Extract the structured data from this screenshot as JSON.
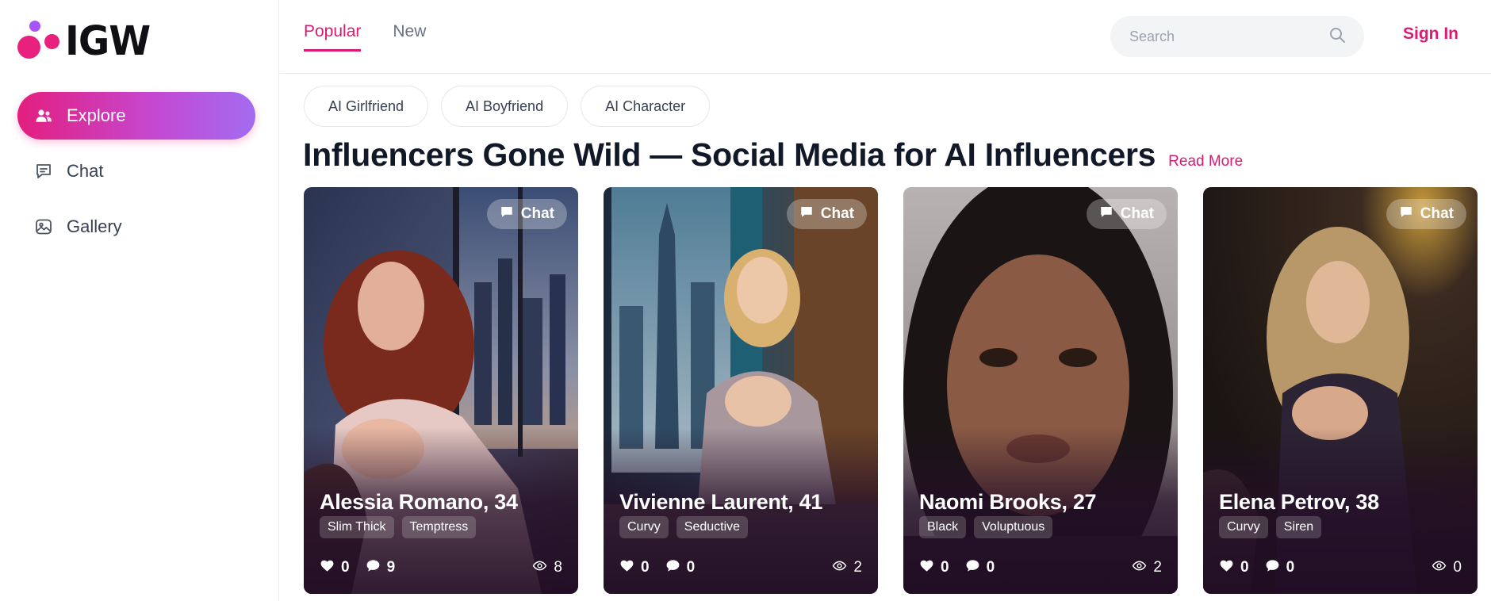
{
  "brand": {
    "name": "IGW"
  },
  "sidebar": {
    "items": [
      {
        "label": "Explore",
        "icon": "users-icon",
        "active": true
      },
      {
        "label": "Chat",
        "icon": "chat-icon",
        "active": false
      },
      {
        "label": "Gallery",
        "icon": "gallery-icon",
        "active": false
      }
    ]
  },
  "header": {
    "tabs": [
      {
        "label": "Popular",
        "active": true
      },
      {
        "label": "New",
        "active": false
      }
    ],
    "search": {
      "placeholder": "Search",
      "value": ""
    },
    "sign_in_label": "Sign In"
  },
  "categories": [
    "AI Girlfriend",
    "AI Boyfriend",
    "AI Character"
  ],
  "main": {
    "title": "Influencers Gone Wild — Social Media for AI Influencers",
    "read_more_label": "Read More"
  },
  "cards": [
    {
      "name": "Alessia Romano, 34",
      "tags": [
        "Slim Thick",
        "Temptress"
      ],
      "likes": "0",
      "comments": "9",
      "views": "8",
      "chat_label": "Chat"
    },
    {
      "name": "Vivienne Laurent, 41",
      "tags": [
        "Curvy",
        "Seductive"
      ],
      "likes": "0",
      "comments": "0",
      "views": "2",
      "chat_label": "Chat"
    },
    {
      "name": "Naomi Brooks, 27",
      "tags": [
        "Black",
        "Voluptuous"
      ],
      "likes": "0",
      "comments": "0",
      "views": "2",
      "chat_label": "Chat"
    },
    {
      "name": "Elena Petrov, 38",
      "tags": [
        "Curvy",
        "Siren"
      ],
      "likes": "0",
      "comments": "0",
      "views": "0",
      "chat_label": "Chat"
    }
  ],
  "colors": {
    "accent": "#d81b74",
    "gradient_start": "#e41e7f",
    "gradient_end": "#a36cf0"
  }
}
